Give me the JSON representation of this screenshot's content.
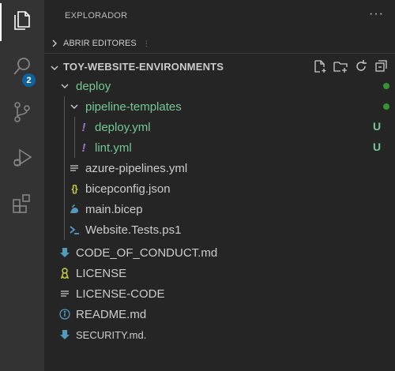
{
  "explorer": {
    "title": "EXPLORADOR",
    "more": "···",
    "open_editors": "ABRIR EDITORES",
    "root": "TOY-WEBSITE-ENVIRONMENTS"
  },
  "activity": {
    "source_control_badge": "2"
  },
  "tree": {
    "deploy": "deploy",
    "pipeline_templates": "pipeline-templates",
    "deploy_yml": "deploy.yml",
    "lint_yml": "lint.yml",
    "azure_pipelines": "azure-pipelines.yml",
    "bicepconfig": "bicepconfig.json",
    "main_bicep": "main.bicep",
    "website_tests": "Website.Tests.ps1",
    "code_of_conduct": "CODE_OF_CONDUCT.md",
    "license": "LICENSE",
    "license_code": "LICENSE-CODE",
    "readme": "README.md",
    "security": "SECURITY.md."
  },
  "status": {
    "untracked": "U",
    "json_icon": "{}",
    "yaml_icon": "!"
  },
  "colors": {
    "activity_bar": "#333333",
    "sidebar": "#252526",
    "git_added": "#73c991",
    "badge": "#0e639c"
  }
}
